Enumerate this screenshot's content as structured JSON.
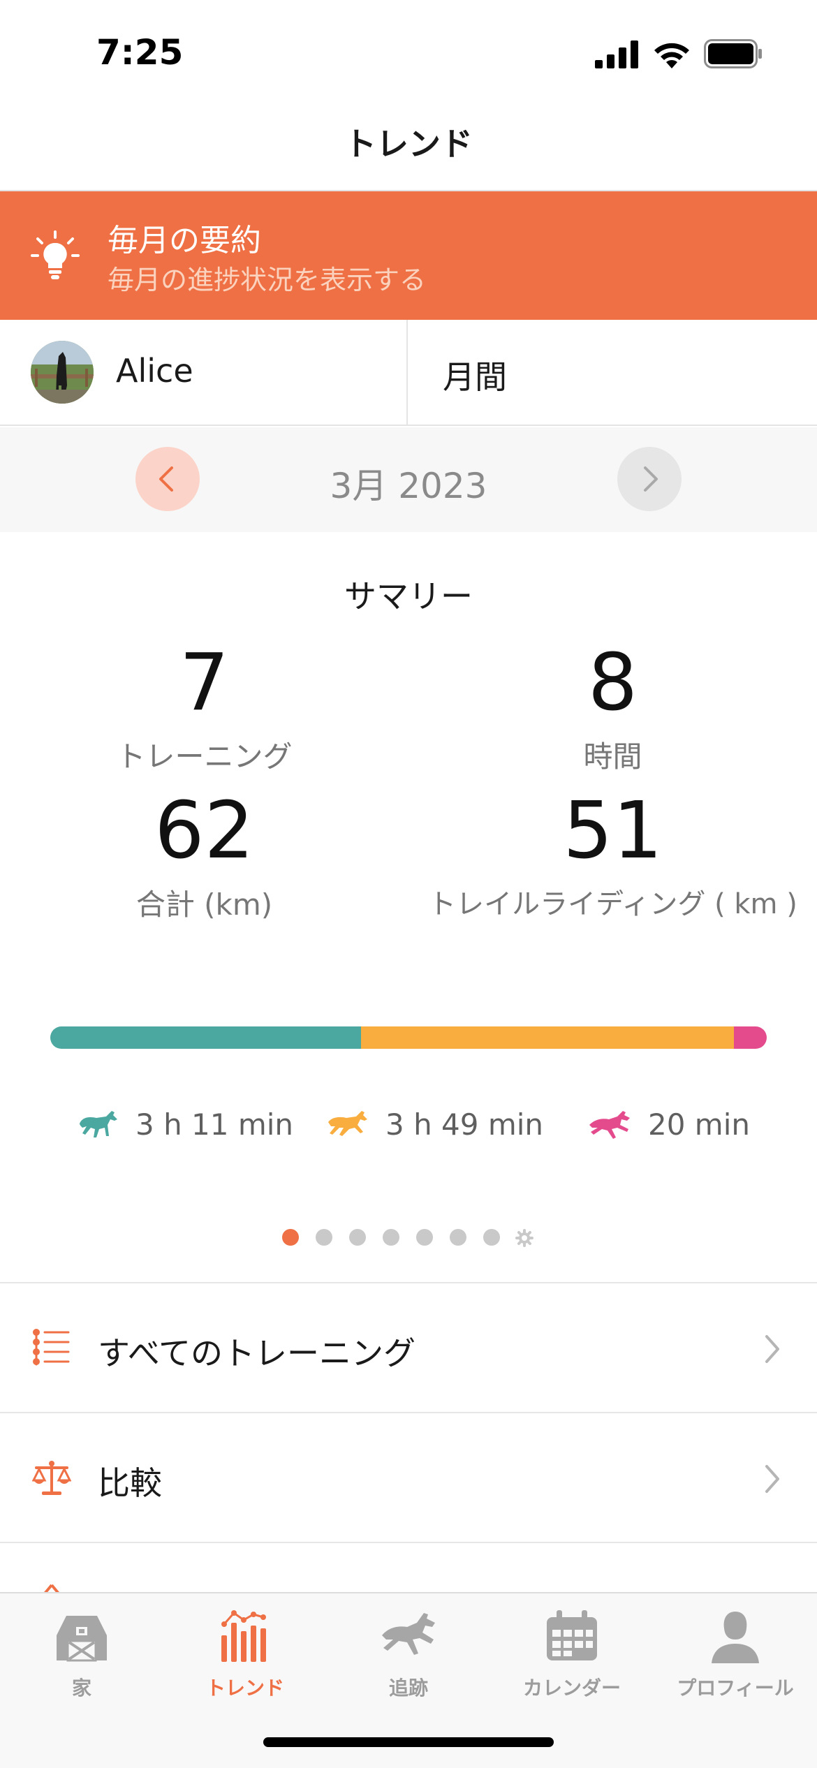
{
  "status_bar": {
    "time": "7:25"
  },
  "nav": {
    "title": "トレンド"
  },
  "banner": {
    "title": "毎月の要約",
    "subtitle": "毎月の進捗状況を表示する",
    "icon": "lightbulb-icon",
    "color": "#ee7044"
  },
  "selector": {
    "horse_name": "Alice",
    "period": "月間"
  },
  "month_nav": {
    "label": "3月 2023"
  },
  "summary": {
    "title": "サマリー",
    "stats": [
      {
        "value": "7",
        "label": "トレーニング"
      },
      {
        "value": "8",
        "label": "時間"
      },
      {
        "value": "62",
        "label": "合計 (km)"
      },
      {
        "value": "51",
        "label": "トレイルライディング ( km )"
      }
    ]
  },
  "gaits": [
    {
      "name": "walk",
      "duration": "3 h 11 min",
      "color": "#4aa8a0",
      "fraction": 0.434
    },
    {
      "name": "trot",
      "duration": "3 h 49 min",
      "color": "#f8ad3e",
      "fraction": 0.52
    },
    {
      "name": "canter",
      "duration": "20 min",
      "color": "#e44b8c",
      "fraction": 0.046
    }
  ],
  "pager": {
    "count": 7,
    "active_index": 0,
    "has_settings": true
  },
  "menu": [
    {
      "label": "すべてのトレーニング",
      "icon": "list-icon"
    },
    {
      "label": "比較",
      "icon": "scale-icon"
    }
  ],
  "tabs": [
    {
      "label": "家",
      "icon": "barn-icon",
      "active": false
    },
    {
      "label": "トレンド",
      "icon": "bar-chart-icon",
      "active": true
    },
    {
      "label": "追跡",
      "icon": "horse-icon",
      "active": false
    },
    {
      "label": "カレンダー",
      "icon": "calendar-icon",
      "active": false
    },
    {
      "label": "プロフィール",
      "icon": "person-icon",
      "active": false
    }
  ]
}
